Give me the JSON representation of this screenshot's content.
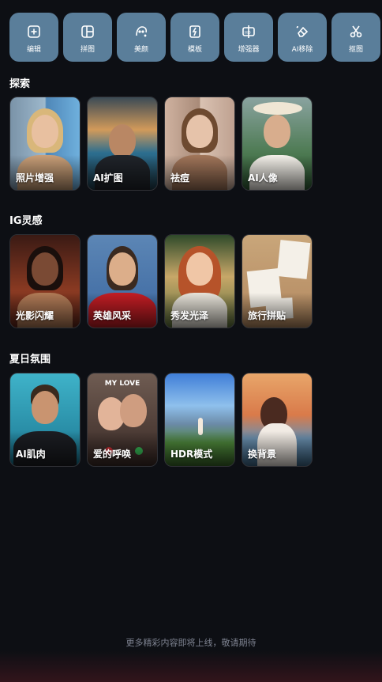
{
  "toolbar": {
    "items": [
      {
        "label": "编辑",
        "icon": "plus-square-icon"
      },
      {
        "label": "拼图",
        "icon": "collage-icon"
      },
      {
        "label": "美颜",
        "icon": "face-retouch-icon"
      },
      {
        "label": "模板",
        "icon": "template-icon"
      },
      {
        "label": "增强器",
        "icon": "hd-enhance-icon"
      },
      {
        "label": "AI移除",
        "icon": "eraser-icon"
      },
      {
        "label": "抠图",
        "icon": "scissors-icon"
      }
    ]
  },
  "sections": [
    {
      "title": "探索",
      "cards": [
        {
          "label": "照片增强"
        },
        {
          "label": "AI扩图"
        },
        {
          "label": "祛痘"
        },
        {
          "label": "AI人像"
        }
      ]
    },
    {
      "title": "IG灵感",
      "cards": [
        {
          "label": "光影闪耀"
        },
        {
          "label": "英雄风采"
        },
        {
          "label": "秀发光泽"
        },
        {
          "label": "旅行拼贴"
        }
      ]
    },
    {
      "title": "夏日氛围",
      "cards": [
        {
          "label": "AI肌肉"
        },
        {
          "label": "爱的呼唤"
        },
        {
          "label": "HDR模式"
        },
        {
          "label": "换背景"
        }
      ]
    }
  ],
  "collage_card": {
    "overlay_text": "MY LOVE"
  },
  "footer": {
    "note": "更多精彩内容即将上线，敬请期待"
  },
  "colors": {
    "tool_button": "#5a7e9a",
    "background": "#0d0f14"
  }
}
